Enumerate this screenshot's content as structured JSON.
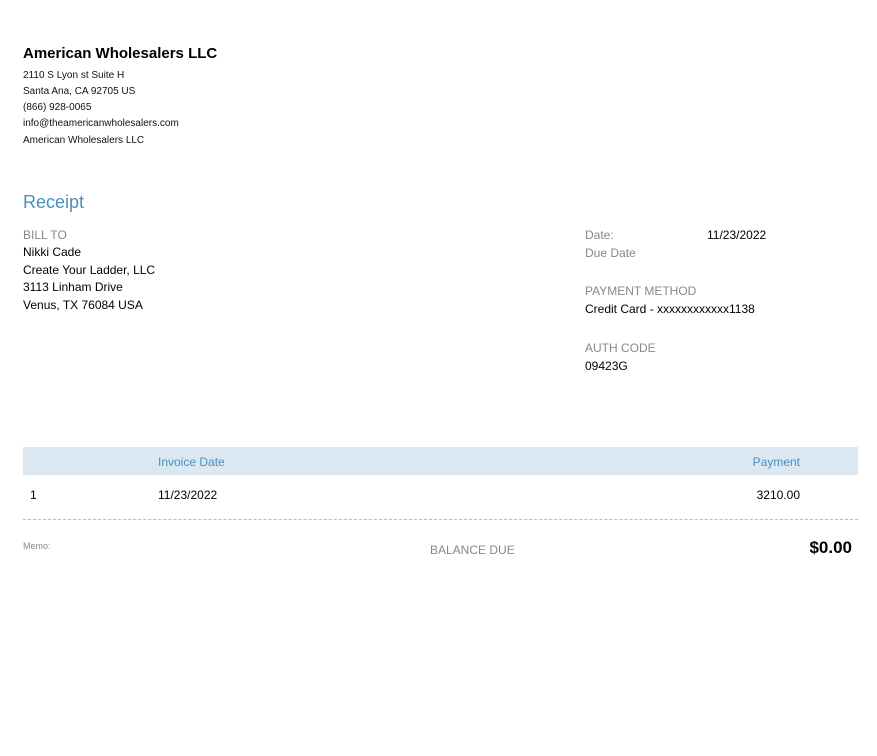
{
  "company": {
    "name": "American Wholesalers LLC",
    "address_lines": [
      "2110 S Lyon st Suite H",
      "Santa Ana, CA  92705 US",
      "(866) 928-0065",
      "info@theamericanwholesalers.com",
      "American Wholesalers LLC"
    ]
  },
  "document": {
    "title": "Receipt"
  },
  "bill_to": {
    "label": "BILL TO",
    "lines": [
      "Nikki Cade",
      "Create Your Ladder, LLC",
      "3113 Linham Drive",
      "Venus, TX  76084 USA"
    ]
  },
  "details": {
    "date_label": "Date:",
    "date_value": "11/23/2022",
    "due_date_label": "Due Date",
    "payment_method_label": "PAYMENT METHOD",
    "payment_method_value": "Credit Card - xxxxxxxxxxxx1138",
    "auth_code_label": "AUTH CODE",
    "auth_code_value": "09423G"
  },
  "table": {
    "headers": {
      "invoice_date": "Invoice Date",
      "payment": "Payment"
    },
    "rows": [
      {
        "number": "1",
        "invoice_date": "11/23/2022",
        "payment": "3210.00"
      }
    ]
  },
  "footer": {
    "memo_label": "Memo:",
    "balance_due_label": "BALANCE DUE",
    "balance_due_value": "$0.00"
  }
}
